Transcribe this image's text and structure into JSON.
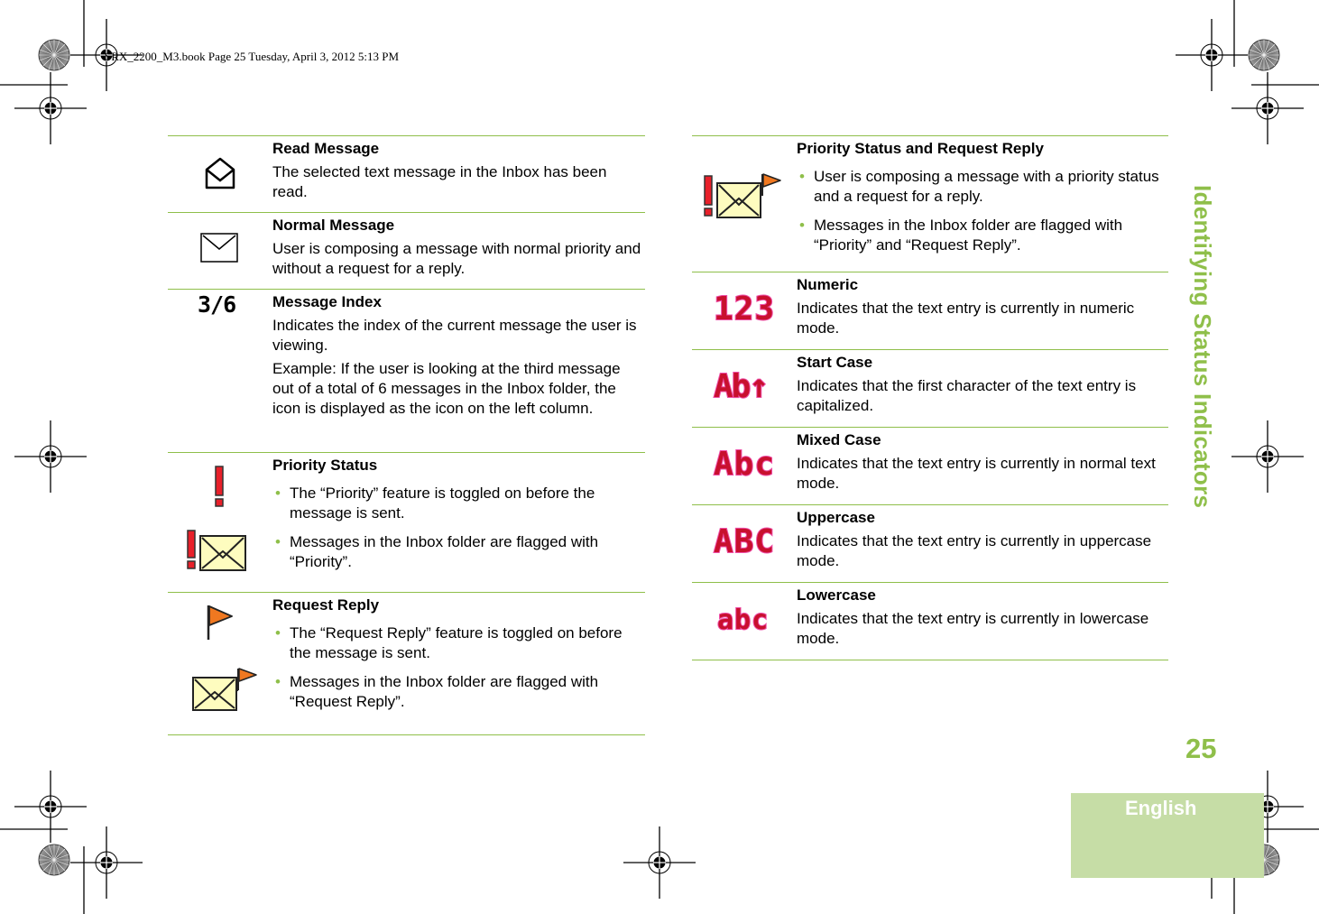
{
  "header": {
    "print_info": "SRX_2200_M3.book  Page 25  Tuesday, April 3, 2012  5:13 PM"
  },
  "side_title": "Identifying Status Indicators",
  "page_number": "25",
  "language_tab": "English",
  "colors": {
    "accent_green": "#8fbf4a",
    "tab_green": "#c6dda6",
    "priority_red": "#e8202a",
    "flag_orange": "#f07820",
    "envelope_yellow": "#fefcbf",
    "pixel_text_red": "#c8102e",
    "pixel_text_pink": "#ee4fa8"
  },
  "left_column": [
    {
      "icon": "read-message-icon",
      "title": "Read Message",
      "paragraphs": [
        "The selected text message in the Inbox has been read."
      ]
    },
    {
      "icon": "normal-message-icon",
      "title": "Normal Message",
      "paragraphs": [
        "User is composing a message with normal priority and without a request for a reply."
      ]
    },
    {
      "icon": "message-index-icon",
      "icon_text": "3/6",
      "title": "Message Index",
      "paragraphs": [
        "Indicates the index of the current message the user is viewing.",
        "Example: If the user is looking at the third message out of a total of 6 messages in the Inbox folder, the icon is displayed as the icon on the left column."
      ]
    },
    {
      "icon": "priority-status-icon",
      "title": "Priority Status",
      "bullets": [
        "The “Priority” feature is toggled on before the message is sent.",
        "Messages in the Inbox folder are flagged with “Priority”."
      ]
    },
    {
      "icon": "request-reply-icon",
      "title": "Request Reply",
      "bullets": [
        "The “Request Reply” feature is toggled on before the message is sent.",
        "Messages in the Inbox folder are flagged with “Request Reply”."
      ]
    }
  ],
  "right_column": [
    {
      "icon": "priority-request-reply-icon",
      "title": "Priority Status and Request Reply",
      "bullets": [
        "User is composing a message with a priority status and a request for a reply.",
        "Messages in the Inbox folder are flagged with “Priority” and “Request Reply”."
      ]
    },
    {
      "icon": "numeric-mode-icon",
      "icon_text": "123",
      "title": "Numeric",
      "paragraphs": [
        "Indicates that the text entry is currently in numeric mode."
      ]
    },
    {
      "icon": "start-case-icon",
      "icon_text": "Ab↑",
      "title": "Start Case",
      "paragraphs": [
        "Indicates that the first character of the text entry is capitalized."
      ]
    },
    {
      "icon": "mixed-case-icon",
      "icon_text": "Abc",
      "title": "Mixed Case",
      "paragraphs": [
        "Indicates that the text entry is currently in normal text mode."
      ]
    },
    {
      "icon": "uppercase-icon",
      "icon_text": "ABC",
      "title": "Uppercase",
      "paragraphs": [
        "Indicates that the text entry is currently in uppercase mode."
      ]
    },
    {
      "icon": "lowercase-icon",
      "icon_text": "abc",
      "title": "Lowercase",
      "paragraphs": [
        "Indicates that the text entry is currently in lowercase mode."
      ]
    }
  ]
}
